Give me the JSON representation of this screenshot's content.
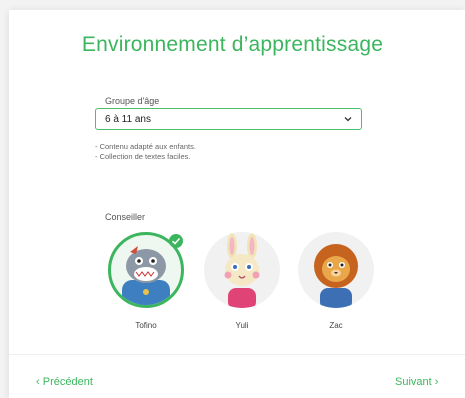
{
  "page": {
    "title": "Environnement d’apprentissage"
  },
  "age_group": {
    "label": "Groupe d'âge",
    "selected": "6 à 11 ans",
    "notes": [
      "- Contenu adapté aux enfants.",
      "- Collection de textes faciles."
    ]
  },
  "advisor": {
    "label": "Conseiller",
    "options": [
      {
        "name": "Tofino",
        "selected": true
      },
      {
        "name": "Yuli",
        "selected": false
      },
      {
        "name": "Zac",
        "selected": false
      }
    ]
  },
  "nav": {
    "prev_label": "Précédent",
    "next_label": "Suivant"
  },
  "colors": {
    "accent": "#3cb65e"
  }
}
